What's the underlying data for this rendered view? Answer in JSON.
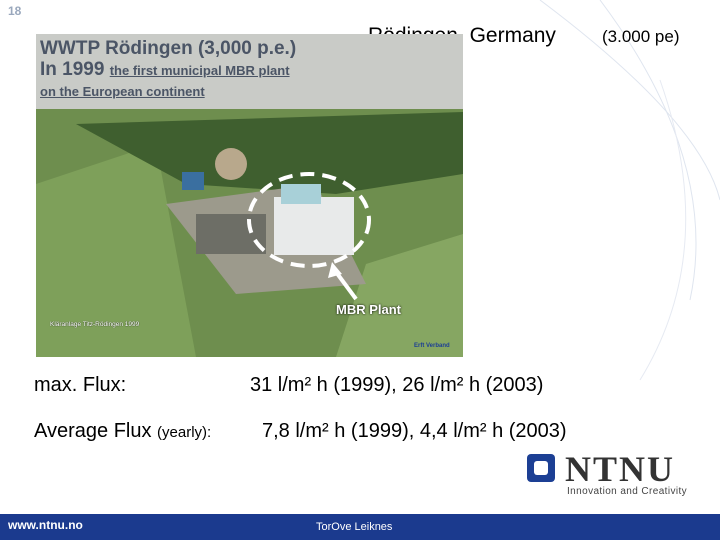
{
  "slide": {
    "number": "18",
    "title_place": "Rödingen, Germany",
    "title_pe": "(3.000 pe)"
  },
  "photo": {
    "line1": "WWTP Rödingen (3,000 p.e.)",
    "line2_prefix": "In 1999",
    "line2_rest": "the first municipal MBR plant",
    "line3": "on the European continent",
    "mbr_label": "MBR Plant",
    "caption": "Kläranlage Titz-Rödingen 1999",
    "logo": "Erft Verband"
  },
  "body": {
    "flux_label": "max. Flux:",
    "flux_value": "31 l/m² h (1999), 26 l/m² h (2003)",
    "avg_label": "Average Flux",
    "avg_label_small": "(yearly):",
    "avg_value": "7,8 l/m² h (1999), 4,4 l/m² h (2003)"
  },
  "logo": {
    "word": "NTNU",
    "tagline": "Innovation and Creativity"
  },
  "footer": {
    "url": "www.ntnu.no",
    "author": "TorOve Leiknes"
  },
  "colors": {
    "brand_blue": "#1b3a8e",
    "slide_number": "#9aa8bd"
  }
}
